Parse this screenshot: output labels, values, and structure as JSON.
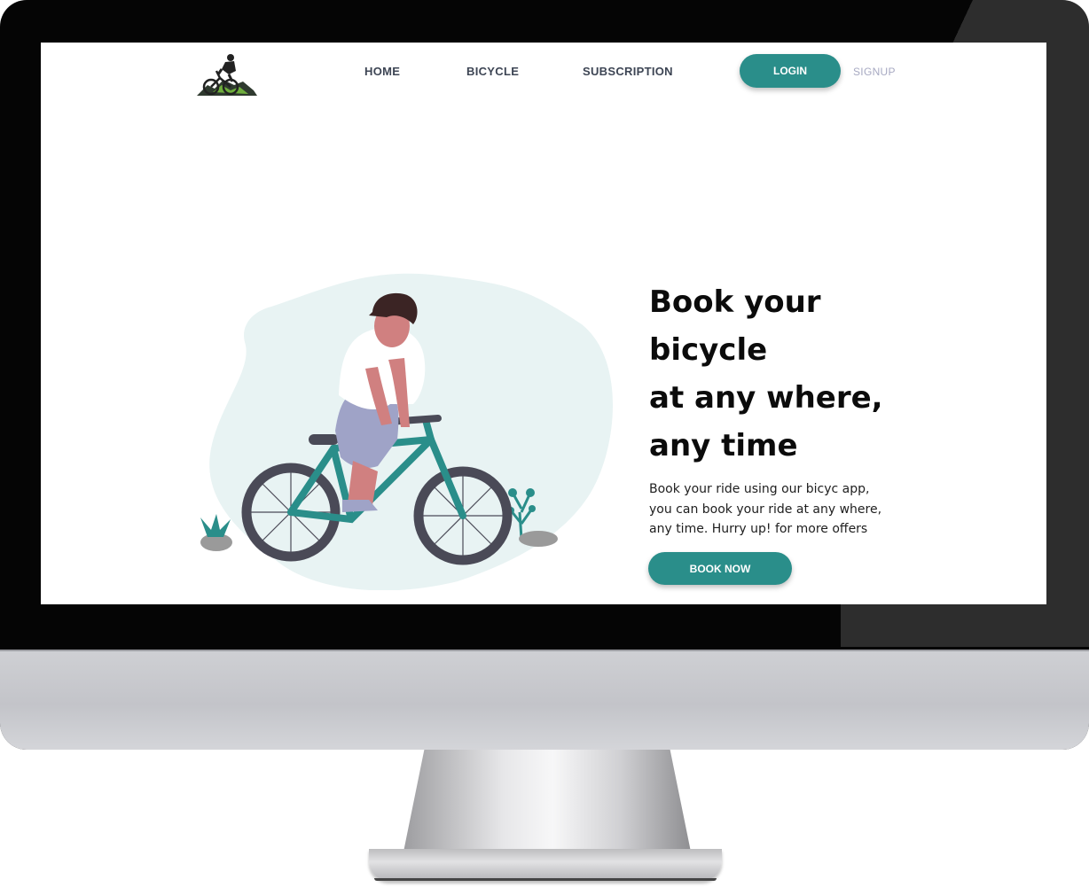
{
  "nav": {
    "links": [
      "HOME",
      "BICYCLE",
      "SUBSCRIPTION"
    ],
    "login_label": "LOGIN",
    "signup_label": "SIGNUP"
  },
  "hero": {
    "title_lines": [
      "Book your",
      "bicycle",
      "at any where,",
      "any time"
    ],
    "description_lines": [
      "Book your ride using our bicyc app,",
      "you can book your ride at any where,",
      "any time. Hurry up! for more offers"
    ],
    "cta_label": "BOOK NOW"
  },
  "colors": {
    "accent": "#2a8e8a",
    "nav_text": "#3d4554",
    "signup_text": "#a7a9c2",
    "blob": "#e8f3f3"
  },
  "icons": {
    "logo": "mountain-biker-logo",
    "illustration": "person-on-bicycle-illustration"
  }
}
